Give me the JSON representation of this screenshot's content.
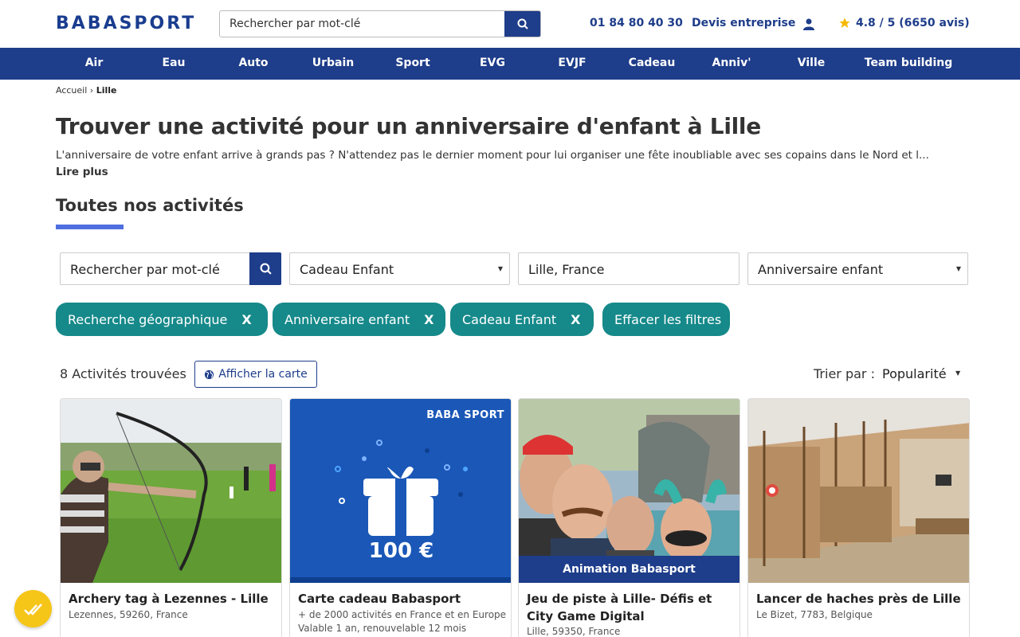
{
  "header": {
    "logo": "BABASPORT",
    "search_placeholder": "Rechercher par mot-clé",
    "phone": "01 84 80 40 30",
    "devis": "Devis entreprise",
    "rating": "4.8 / 5 (6650 avis)"
  },
  "nav": [
    "Air",
    "Eau",
    "Auto",
    "Urbain",
    "Sport",
    "EVG",
    "EVJF",
    "Cadeau",
    "Anniv'",
    "Ville",
    "Team building"
  ],
  "breadcrumb": {
    "home": "Accueil",
    "sep": " › ",
    "current": "Lille"
  },
  "page": {
    "title": "Trouver une activité pour un anniversaire d'enfant à Lille",
    "description": "L'anniversaire de votre enfant arrive à grands pas ? N'attendez pas le dernier moment pour lui organiser une fête inoubliable avec ses copains dans le Nord et l...",
    "read_more": "Lire plus",
    "section_title": "Toutes nos activités"
  },
  "filters": {
    "search_placeholder": "Rechercher par mot-clé",
    "category": "Cadeau Enfant",
    "location": "Lille, France",
    "occasion": "Anniversaire enfant"
  },
  "chips": [
    {
      "label": "Recherche géographique",
      "x": "X"
    },
    {
      "label": "Anniversaire enfant",
      "x": "X"
    },
    {
      "label": "Cadeau Enfant",
      "x": "X"
    },
    {
      "label": "Effacer les filtres",
      "x": ""
    }
  ],
  "results": {
    "count": "8 Activités trouvées",
    "map_button": "Afficher la carte",
    "sort_label": "Trier par :",
    "sort_value": "Popularité"
  },
  "cards": [
    {
      "title": "Archery tag à Lezennes - Lille",
      "location": "Lezennes, 59260, France",
      "extra": ""
    },
    {
      "title": "Carte cadeau Babasport",
      "location": "+ de 2000 activités en France et en Europe",
      "extra": "Valable 1 an, renouvelable 12 mois",
      "img_brand": "BABA SPORT",
      "img_amount": "100 €"
    },
    {
      "title": "Jeu de piste à Lille- Défis et City Game Digital",
      "location": "Lille, 59350, France",
      "extra": "",
      "banner": "Animation Babasport"
    },
    {
      "title": "Lancer de haches près de Lille",
      "location": "Le Bizet, 7783, Belgique",
      "extra": ""
    }
  ],
  "colors": {
    "brand": "#1e3d8a",
    "chip": "#16898a",
    "accent": "#4f6fe0",
    "fab": "#f5c518"
  }
}
